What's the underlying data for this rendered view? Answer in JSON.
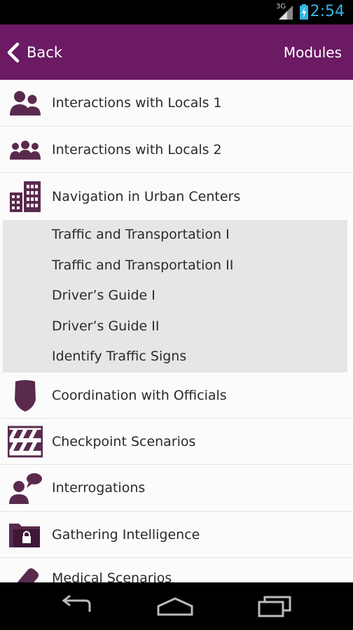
{
  "status_bar": {
    "network": "3G",
    "time": "2:54",
    "clock_color": "#33b5e5"
  },
  "action_bar": {
    "back_label": "Back",
    "title": "Modules",
    "color": "#6b1a63"
  },
  "modules": [
    {
      "label": "Interactions with Locals 1",
      "icon": "two-people-icon"
    },
    {
      "label": "Interactions with Locals 2",
      "icon": "three-people-icon"
    },
    {
      "label": "Navigation in Urban Centers",
      "icon": "buildings-icon"
    },
    {
      "label": "Coordination with Officials",
      "icon": "shield-badge-icon"
    },
    {
      "label": "Checkpoint Scenarios",
      "icon": "barrier-icon"
    },
    {
      "label": "Interrogations",
      "icon": "person-speech-icon"
    },
    {
      "label": "Gathering Intelligence",
      "icon": "locked-folder-icon"
    },
    {
      "label": "Medical Scenarios",
      "icon": "medical-icon"
    }
  ],
  "submodules": [
    {
      "label": "Traffic and Transportation I"
    },
    {
      "label": "Traffic and Transportation II"
    },
    {
      "label": "Driver’s Guide I"
    },
    {
      "label": "Driver’s Guide II"
    },
    {
      "label": "Identify Traffic Signs"
    }
  ],
  "nav_bar": {
    "back_icon": "back-arrow-icon",
    "home_icon": "home-icon",
    "recents_icon": "recent-apps-icon"
  }
}
